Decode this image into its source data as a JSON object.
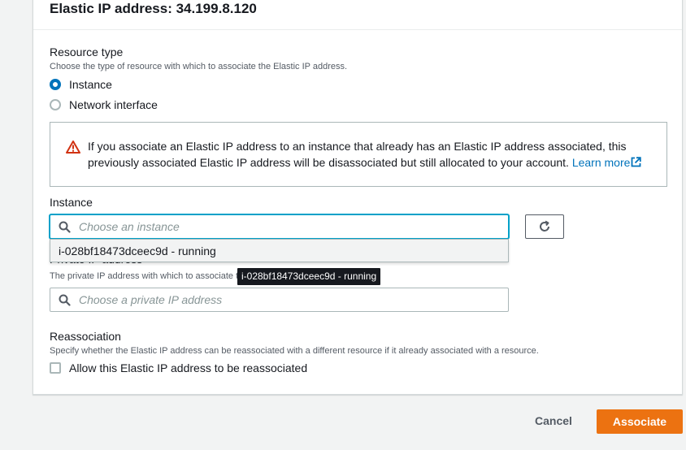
{
  "panel": {
    "title": "Elastic IP address: 34.199.8.120"
  },
  "resource_type": {
    "label": "Resource type",
    "description": "Choose the type of resource with which to associate the Elastic IP address.",
    "options": [
      {
        "label": "Instance",
        "selected": true
      },
      {
        "label": "Network interface",
        "selected": false
      }
    ]
  },
  "alert": {
    "text": "If you associate an Elastic IP address to an instance that already has an Elastic IP address associated, this previously associated Elastic IP address will be disassociated but still allocated to your account.",
    "link_label": "Learn more",
    "icon": "warning-icon",
    "color": "#d13212"
  },
  "instance": {
    "label": "Instance",
    "placeholder": "Choose an instance",
    "dropdown_option": "i-028bf18473dceec9d - running",
    "refresh_icon": "refresh-icon"
  },
  "private_ip": {
    "label": "Private IP address",
    "description": "The private IP address with which to associate the Elastic IP address.",
    "placeholder": "Choose a private IP address"
  },
  "tooltip": {
    "text": "i-028bf18473dceec9d - running"
  },
  "reassociation": {
    "label": "Reassociation",
    "description": "Specify whether the Elastic IP address can be reassociated with a different resource if it already associated with a resource.",
    "checkbox_label": "Allow this Elastic IP address to be reassociated",
    "checked": false
  },
  "footer": {
    "cancel_label": "Cancel",
    "associate_label": "Associate",
    "accent_color": "#ec7211"
  }
}
